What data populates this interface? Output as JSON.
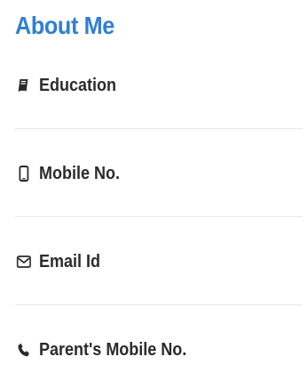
{
  "colors": {
    "title": "#2f7fd2",
    "text": "#2b2b2b",
    "divider": "#e7e7e7"
  },
  "section": {
    "title": "About Me",
    "items": [
      {
        "label": "Education",
        "icon": "book-icon"
      },
      {
        "label": "Mobile No.",
        "icon": "mobile-icon"
      },
      {
        "label": "Email Id",
        "icon": "envelope-icon"
      },
      {
        "label": "Parent's Mobile No.",
        "icon": "phone-icon"
      }
    ]
  }
}
